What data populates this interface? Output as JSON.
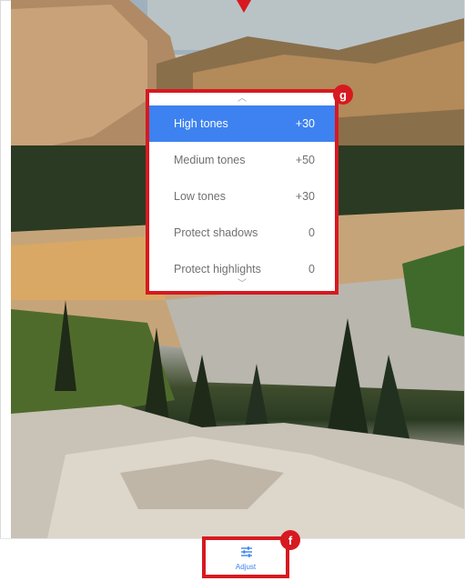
{
  "panel": {
    "items": [
      {
        "label": "High tones",
        "value": "+30",
        "selected": true
      },
      {
        "label": "Medium tones",
        "value": "+50",
        "selected": false
      },
      {
        "label": "Low tones",
        "value": "+30",
        "selected": false
      },
      {
        "label": "Protect shadows",
        "value": "0",
        "selected": false
      },
      {
        "label": "Protect highlights",
        "value": "0",
        "selected": false
      }
    ],
    "scroll_up_icon": "chevron-up-icon",
    "scroll_down_icon": "chevron-down-icon"
  },
  "callouts": {
    "panel_badge": "g",
    "adjust_badge": "f"
  },
  "bottom_bar": {
    "adjust_label": "Adjust",
    "adjust_icon": "sliders-icon"
  },
  "colors": {
    "accent": "#3d82f0",
    "callout_red": "#d71920"
  }
}
